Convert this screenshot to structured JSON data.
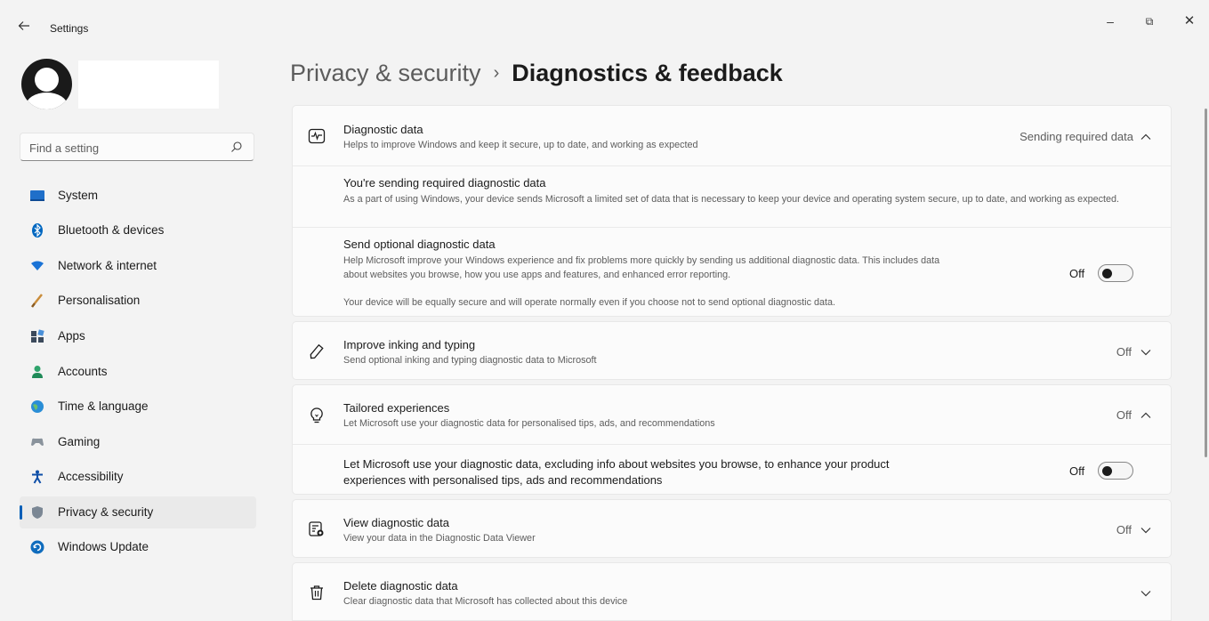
{
  "window": {
    "title": "Settings",
    "controls": {
      "minimize": "–",
      "maximize": "⧉",
      "close": "✕"
    }
  },
  "search": {
    "placeholder": "Find a setting"
  },
  "sidebar": {
    "items": [
      {
        "label": "System",
        "icon": "system-icon",
        "active": false
      },
      {
        "label": "Bluetooth & devices",
        "icon": "bluetooth-icon",
        "active": false
      },
      {
        "label": "Network & internet",
        "icon": "network-icon",
        "active": false
      },
      {
        "label": "Personalisation",
        "icon": "brush-icon",
        "active": false
      },
      {
        "label": "Apps",
        "icon": "apps-icon",
        "active": false
      },
      {
        "label": "Accounts",
        "icon": "accounts-icon",
        "active": false
      },
      {
        "label": "Time & language",
        "icon": "globe-icon",
        "active": false
      },
      {
        "label": "Gaming",
        "icon": "gamepad-icon",
        "active": false
      },
      {
        "label": "Accessibility",
        "icon": "accessibility-icon",
        "active": false
      },
      {
        "label": "Privacy & security",
        "icon": "shield-icon",
        "active": true
      },
      {
        "label": "Windows Update",
        "icon": "update-icon",
        "active": false
      }
    ]
  },
  "header": {
    "parent": "Privacy & security",
    "separator": "›",
    "current": "Diagnostics & feedback"
  },
  "diagnostic_data": {
    "title": "Diagnostic data",
    "description": "Helps to improve Windows and keep it secure, up to date, and working as expected",
    "status": "Sending required data",
    "expanded": true,
    "required": {
      "title": "You're sending required diagnostic data",
      "description": "As a part of using Windows, your device sends Microsoft a limited set of data that is necessary to keep your device and operating system secure, up to date, and working as expected."
    },
    "optional": {
      "title": "Send optional diagnostic data",
      "description": "Help Microsoft improve your Windows experience and fix problems more quickly by sending us additional diagnostic data. This includes data about websites you browse, how you use apps and features, and enhanced error reporting.",
      "note": "Your device will be equally secure and will operate normally even if you choose not to send optional diagnostic data.",
      "toggle_label": "Off",
      "toggle_on": false
    }
  },
  "inking": {
    "title": "Improve inking and typing",
    "description": "Send optional inking and typing diagnostic data to Microsoft",
    "status": "Off",
    "expanded": false
  },
  "tailored": {
    "title": "Tailored experiences",
    "description": "Let Microsoft use your diagnostic data for personalised tips, ads, and recommendations",
    "status": "Off",
    "expanded": true,
    "sub_text": "Let Microsoft use your diagnostic data, excluding info about websites you browse, to enhance your product experiences with personalised tips, ads and recommendations",
    "toggle_label": "Off",
    "toggle_on": false
  },
  "view_data": {
    "title": "View diagnostic data",
    "description": "View your data in the Diagnostic Data Viewer",
    "status": "Off",
    "expanded": false
  },
  "delete_data": {
    "title": "Delete diagnostic data",
    "description": "Clear diagnostic data that Microsoft has collected about this device",
    "expanded": false
  },
  "colors": {
    "accent": "#005fb8",
    "background": "#f3f3f3",
    "card": "#fbfbfb"
  }
}
